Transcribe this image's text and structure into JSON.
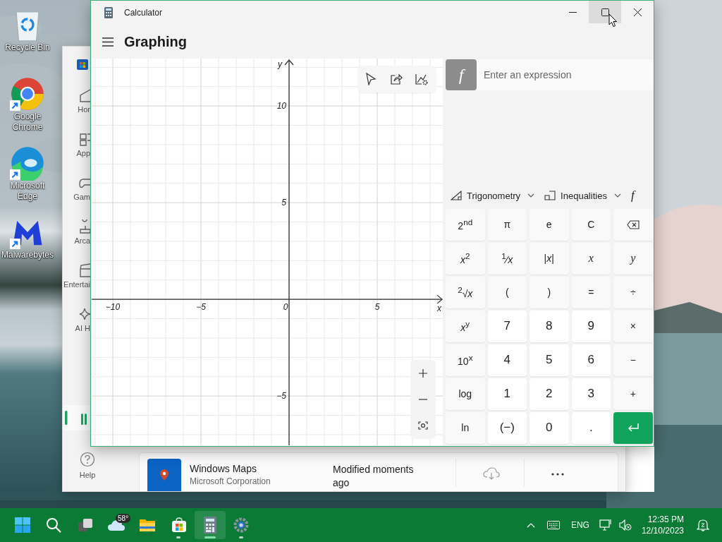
{
  "desktop_icons": [
    {
      "label": "Recycle Bin",
      "kind": "recycle",
      "shortcut": false
    },
    {
      "label": "Google Chrome",
      "kind": "chrome",
      "shortcut": true
    },
    {
      "label": "Microsoft Edge",
      "kind": "edge",
      "shortcut": true
    },
    {
      "label": "Malwarebytes",
      "kind": "malwarebytes",
      "shortcut": true
    }
  ],
  "store_window": {
    "nav_items": [
      {
        "label": "Hor",
        "kind": "home"
      },
      {
        "label": "App",
        "kind": "apps"
      },
      {
        "label": "Gam",
        "kind": "gaming"
      },
      {
        "label": "Arca",
        "kind": "arcade"
      },
      {
        "label": "Entertai",
        "kind": "movies"
      },
      {
        "label": "AI H",
        "kind": "ai"
      }
    ],
    "help": "Help",
    "app_row": {
      "name": "Windows Maps",
      "publisher": "Microsoft Corporation",
      "status": "Modified moments ago"
    }
  },
  "calculator": {
    "title": "Calculator",
    "window_controls": [
      {
        "kind": "minimize",
        "hovered": false
      },
      {
        "kind": "maximize",
        "hovered": true
      },
      {
        "kind": "close",
        "hovered": false
      }
    ],
    "mode": "Graphing",
    "graph": {
      "chart_data": {
        "type": "line",
        "grid": true,
        "xlabel": "x",
        "ylabel": "y",
        "xlim": [
          -11.2,
          8.72
        ],
        "ylim": [
          -7.55,
          12.45
        ],
        "xticks": [
          {
            "value": -10,
            "label": "−10"
          },
          {
            "value": -5,
            "label": "−5"
          },
          {
            "value": 0,
            "label": "0"
          },
          {
            "value": 5,
            "label": "5"
          }
        ],
        "yticks": [
          {
            "value": 10,
            "label": "10"
          },
          {
            "value": 5,
            "label": "5"
          },
          {
            "value": -5,
            "label": "−5"
          }
        ]
      }
    },
    "function_symbol": "f",
    "expression_placeholder": "Enter an expression",
    "function_tabs": [
      {
        "kind": "trig",
        "label": "Trigonometry"
      },
      {
        "kind": "ineq",
        "label": "Inequalities"
      },
      {
        "kind": "func",
        "symbol": "f"
      }
    ],
    "keys": [
      {
        "label": "2$^{nd}$",
        "kind": "fn"
      },
      {
        "label": "π",
        "kind": "fn"
      },
      {
        "label": "e",
        "kind": "fn"
      },
      {
        "label": "C",
        "kind": "fn"
      },
      {
        "kind": "backspace"
      },
      {
        "label": "*x*$^{2}$",
        "kind": "fn"
      },
      {
        "label": "$^{1}$⁄*x*",
        "kind": "fn"
      },
      {
        "label": "|*x*|",
        "kind": "fn"
      },
      {
        "label": "x",
        "kind": "var"
      },
      {
        "label": "y",
        "kind": "var"
      },
      {
        "label": "$^{2}$√*x*",
        "kind": "fn"
      },
      {
        "label": "(",
        "kind": "fn"
      },
      {
        "label": ")",
        "kind": "fn"
      },
      {
        "label": "=",
        "kind": "fn"
      },
      {
        "label": "÷",
        "kind": "fn"
      },
      {
        "label": "*x*$^{y}$",
        "kind": "fn"
      },
      {
        "label": "7",
        "kind": "num"
      },
      {
        "label": "8",
        "kind": "num"
      },
      {
        "label": "9",
        "kind": "num"
      },
      {
        "label": "×",
        "kind": "fn"
      },
      {
        "label": "10$^{x}$",
        "kind": "fn"
      },
      {
        "label": "4",
        "kind": "num"
      },
      {
        "label": "5",
        "kind": "num"
      },
      {
        "label": "6",
        "kind": "num"
      },
      {
        "label": "−",
        "kind": "fn"
      },
      {
        "label": "log",
        "kind": "fn"
      },
      {
        "label": "1",
        "kind": "num"
      },
      {
        "label": "2",
        "kind": "num"
      },
      {
        "label": "3",
        "kind": "num"
      },
      {
        "label": "+",
        "kind": "fn"
      },
      {
        "label": "ln",
        "kind": "fn"
      },
      {
        "label": "(−)",
        "kind": "num"
      },
      {
        "label": "0",
        "kind": "num"
      },
      {
        "label": ".",
        "kind": "num"
      },
      {
        "kind": "enter"
      }
    ]
  },
  "taskbar": {
    "apps": [
      {
        "kind": "start",
        "running": false,
        "selected": false
      },
      {
        "kind": "search",
        "running": false,
        "selected": false
      },
      {
        "kind": "taskview",
        "running": false,
        "selected": false
      },
      {
        "kind": "weather",
        "badge": "58°",
        "running": false,
        "selected": false
      },
      {
        "kind": "explorer",
        "running": false,
        "selected": false
      },
      {
        "kind": "store",
        "running": true,
        "selected": false
      },
      {
        "kind": "calculator",
        "running": true,
        "selected": true
      },
      {
        "kind": "settings",
        "running": true,
        "selected": false
      }
    ],
    "tray": {
      "language": "ENG",
      "time": "12:35 PM",
      "date": "12/10/2023"
    }
  }
}
